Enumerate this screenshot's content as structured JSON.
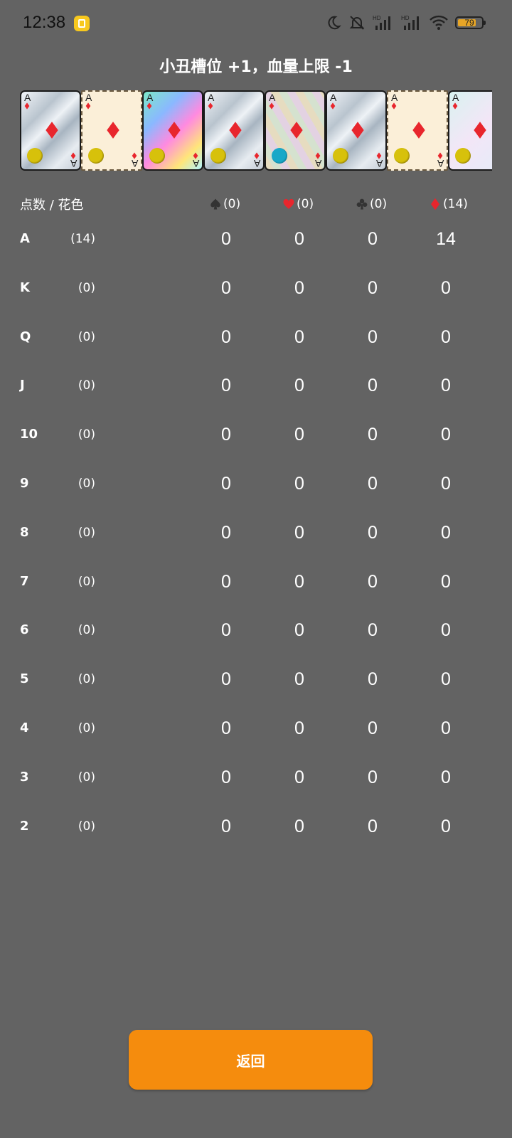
{
  "status_bar": {
    "time": "12:38",
    "battery": "79",
    "battery_level": 0.79,
    "icons": [
      "moon-icon",
      "mute-icon",
      "signal-hd-icon",
      "signal-hd-icon",
      "wifi-icon",
      "battery-icon"
    ]
  },
  "title": "小丑槽位 +1，血量上限 -1",
  "cards": [
    {
      "rank": "A",
      "suit": "diamond",
      "style": "foil",
      "chip": "gold"
    },
    {
      "rank": "A",
      "suit": "diamond",
      "style": "paper",
      "chip": "gold"
    },
    {
      "rank": "A",
      "suit": "diamond",
      "style": "polychrome",
      "chip": "gold"
    },
    {
      "rank": "A",
      "suit": "diamond",
      "style": "foil",
      "chip": "gold"
    },
    {
      "rank": "A",
      "suit": "diamond",
      "style": "holographic",
      "chip": "blue"
    },
    {
      "rank": "A",
      "suit": "diamond",
      "style": "foil",
      "chip": "gold"
    },
    {
      "rank": "A",
      "suit": "diamond",
      "style": "paper",
      "chip": "gold"
    },
    {
      "rank": "A",
      "suit": "diamond",
      "style": "holographic",
      "chip": "gold"
    }
  ],
  "table": {
    "header_label": "点数 / 花色",
    "suits": [
      {
        "icon": "spade-icon",
        "count": "(0)",
        "color": "#333333"
      },
      {
        "icon": "heart-icon",
        "count": "(0)",
        "color": "#e8262d"
      },
      {
        "icon": "club-icon",
        "count": "(0)",
        "color": "#333333"
      },
      {
        "icon": "diamond-icon",
        "count": "(14)",
        "color": "#e8262d"
      }
    ],
    "rows": [
      {
        "rank": "A",
        "count": "(14)",
        "values": [
          "0",
          "0",
          "0",
          "14"
        ]
      },
      {
        "rank": "K",
        "count": "(0)",
        "values": [
          "0",
          "0",
          "0",
          "0"
        ]
      },
      {
        "rank": "Q",
        "count": "(0)",
        "values": [
          "0",
          "0",
          "0",
          "0"
        ]
      },
      {
        "rank": "J",
        "count": "(0)",
        "values": [
          "0",
          "0",
          "0",
          "0"
        ]
      },
      {
        "rank": "10",
        "count": "(0)",
        "values": [
          "0",
          "0",
          "0",
          "0"
        ]
      },
      {
        "rank": "9",
        "count": "(0)",
        "values": [
          "0",
          "0",
          "0",
          "0"
        ]
      },
      {
        "rank": "8",
        "count": "(0)",
        "values": [
          "0",
          "0",
          "0",
          "0"
        ]
      },
      {
        "rank": "7",
        "count": "(0)",
        "values": [
          "0",
          "0",
          "0",
          "0"
        ]
      },
      {
        "rank": "6",
        "count": "(0)",
        "values": [
          "0",
          "0",
          "0",
          "0"
        ]
      },
      {
        "rank": "5",
        "count": "(0)",
        "values": [
          "0",
          "0",
          "0",
          "0"
        ]
      },
      {
        "rank": "4",
        "count": "(0)",
        "values": [
          "0",
          "0",
          "0",
          "0"
        ]
      },
      {
        "rank": "3",
        "count": "(0)",
        "values": [
          "0",
          "0",
          "0",
          "0"
        ]
      },
      {
        "rank": "2",
        "count": "(0)",
        "values": [
          "0",
          "0",
          "0",
          "0"
        ]
      }
    ]
  },
  "back_button": "返回",
  "colors": {
    "background": "#636363",
    "accent": "#f58c0d",
    "diamond": "#e8262d"
  }
}
